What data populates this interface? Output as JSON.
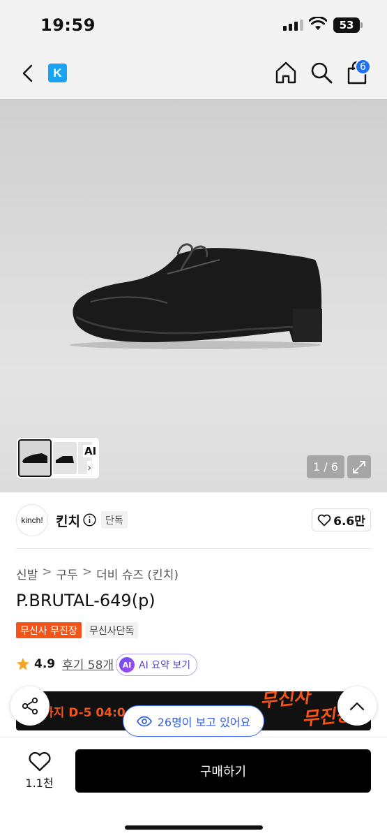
{
  "status_bar": {
    "time": "19:59",
    "battery": "53"
  },
  "header": {
    "logo_letter": "K",
    "cart_count": "6"
  },
  "gallery": {
    "counter": "1 / 6",
    "thumb_ai_label": "AI",
    "thumb_chevron": "›"
  },
  "brand": {
    "logo_text": "kinch!",
    "name": "킨치",
    "tag": "단독",
    "likes": "6.6만"
  },
  "product": {
    "breadcrumb": [
      "신발",
      "구두",
      "더비 슈즈 (킨치)"
    ],
    "breadcrumb_sep": ">",
    "title": "P.BRUTAL-649(p)",
    "badges": [
      "무신사 무진장",
      "무신사단독"
    ],
    "rating": "4.9",
    "reviews": "후기 58개",
    "ai_summary": "AI 요약 보기",
    "ai_icon": "AI"
  },
  "promo": {
    "text": "까지 D-5 04:0",
    "art_line1": "무신사",
    "art_line2": "무진장"
  },
  "viewers": {
    "text": "26명이 보고 있어요"
  },
  "bottom": {
    "wish_count": "1.1천",
    "buy_label": "구매하기"
  },
  "colors": {
    "accent_blue": "#1f6ff2",
    "promo_orange": "#f3541a",
    "ai_purple": "#5b3fd8"
  }
}
